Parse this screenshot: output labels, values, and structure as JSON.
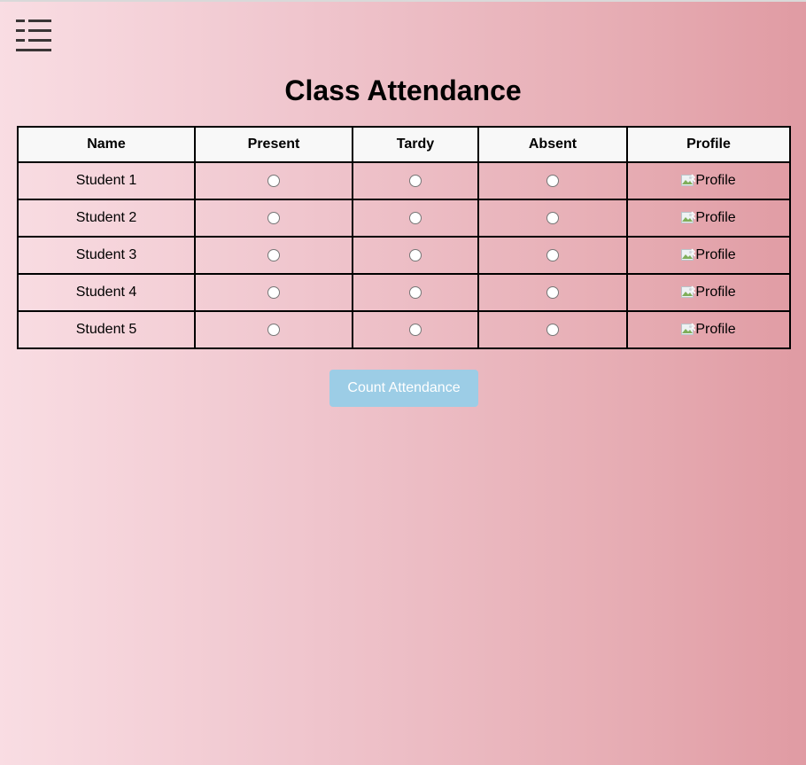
{
  "header": {
    "menu_icon": "hamburger-menu-icon",
    "title": "Class Attendance"
  },
  "table": {
    "columns": [
      "Name",
      "Present",
      "Tardy",
      "Absent",
      "Profile"
    ],
    "rows": [
      {
        "name": "Student 1",
        "present": false,
        "tardy": false,
        "absent": false,
        "profile": "Profile",
        "profile_icon": "broken-image-icon"
      },
      {
        "name": "Student 2",
        "present": false,
        "tardy": false,
        "absent": false,
        "profile": "Profile",
        "profile_icon": "broken-image-icon"
      },
      {
        "name": "Student 3",
        "present": false,
        "tardy": false,
        "absent": false,
        "profile": "Profile",
        "profile_icon": "broken-image-icon"
      },
      {
        "name": "Student 4",
        "present": false,
        "tardy": false,
        "absent": false,
        "profile": "Profile",
        "profile_icon": "broken-image-icon"
      },
      {
        "name": "Student 5",
        "present": false,
        "tardy": false,
        "absent": false,
        "profile": "Profile",
        "profile_icon": "broken-image-icon"
      }
    ]
  },
  "actions": {
    "count_label": "Count Attendance"
  },
  "colors": {
    "button_bg": "#9ccde6",
    "button_text": "#ffffff",
    "header_bg": "#f8f8f8",
    "gradient_start": "#f9dde3",
    "gradient_end": "#e09ba3"
  }
}
